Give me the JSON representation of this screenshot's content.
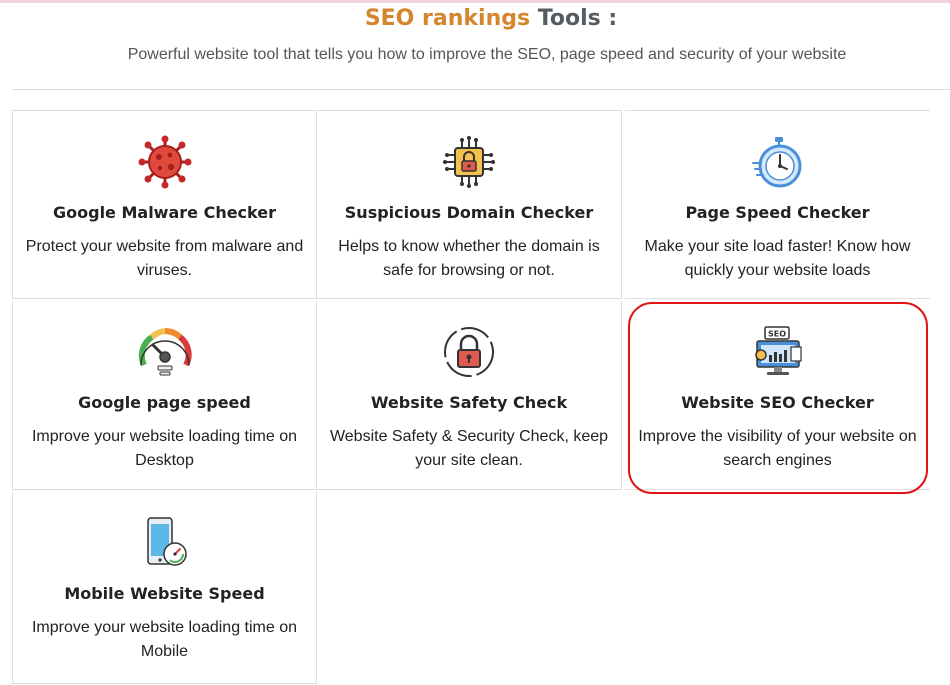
{
  "header": {
    "title_part1": "SEO rankings",
    "title_part2": "Tools :",
    "subtitle": "Powerful website tool that tells you how to improve the SEO, page speed and security of your website"
  },
  "colors": {
    "accent": "#d4862c",
    "title_dark": "#555d63",
    "highlight": "#e01515"
  },
  "tools": [
    {
      "name": "Google Malware Checker",
      "desc": "Protect your website from malware and viruses.",
      "icon": "virus-icon"
    },
    {
      "name": "Suspicious Domain Checker",
      "desc": "Helps to know whether the domain is safe for browsing or not.",
      "icon": "chip-lock-icon"
    },
    {
      "name": "Page Speed Checker",
      "desc": "Make your site load faster! Know how quickly your website loads",
      "icon": "stopwatch-icon"
    },
    {
      "name": "Google page speed",
      "desc": "Improve your website loading time on Desktop",
      "icon": "speedometer-icon"
    },
    {
      "name": "Website Safety Check",
      "desc": "Website Safety & Security Check, keep your site clean.",
      "icon": "padlock-icon"
    },
    {
      "name": "Website SEO Checker",
      "desc": "Improve the visibility of your website on search engines",
      "icon": "seo-monitor-icon"
    },
    {
      "name": "Mobile Website Speed",
      "desc": "Improve your website loading time on Mobile",
      "icon": "mobile-speed-icon"
    }
  ]
}
